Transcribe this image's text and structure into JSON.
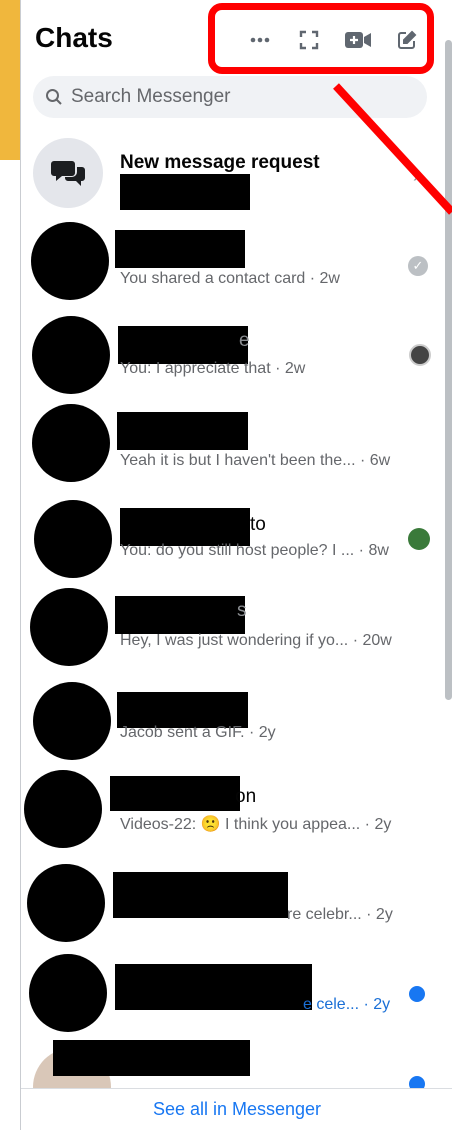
{
  "header": {
    "title": "Chats"
  },
  "toolbar": [
    {
      "name": "more-options-icon",
      "icon": "ellipsis"
    },
    {
      "name": "expand-icon",
      "icon": "expand-arrows"
    },
    {
      "name": "new-room-icon",
      "icon": "video-plus"
    },
    {
      "name": "new-message-icon",
      "icon": "compose"
    }
  ],
  "search": {
    "placeholder": "Search Messenger",
    "value": ""
  },
  "request": {
    "title": "New message request"
  },
  "chats": [
    {
      "name_tail": "",
      "snippet": "You shared a contact card · 2w",
      "status": "read-check",
      "unread": false
    },
    {
      "name_tail": "e",
      "snippet": "You: I appreciate that · 2w",
      "status": "seen-avatar",
      "unread": false
    },
    {
      "name_tail": "",
      "snippet": "Yeah it is but I haven't been the... · 6w",
      "status": "none",
      "unread": false
    },
    {
      "name_tail": "to",
      "snippet": "You: do you still host people? I ... · 8w",
      "status": "seen-avatar",
      "unread": false
    },
    {
      "name_tail": "s",
      "snippet": "Hey, I was just wondering if yo... · 20w",
      "status": "none",
      "unread": false
    },
    {
      "name_tail": "",
      "snippet": "Jacob sent a GIF. · 2y",
      "status": "none",
      "unread": false
    },
    {
      "name_tail": "on",
      "snippet": "Videos-22: 🙁 I think you appea... · 2y",
      "status": "none",
      "unread": false
    },
    {
      "name_tail": "",
      "snippet": "re celebr... · 2y",
      "status": "none",
      "unread": false
    },
    {
      "name_tail": "",
      "snippet": "e cele... · 2y",
      "status": "unread-dot",
      "unread": true
    },
    {
      "name_tail": "",
      "snippet": "",
      "status": "unread-dot",
      "unread": true
    }
  ],
  "footer": {
    "link": "See all in Messenger"
  },
  "colors": {
    "accent": "#1877f2",
    "highlight": "#ff0000"
  }
}
